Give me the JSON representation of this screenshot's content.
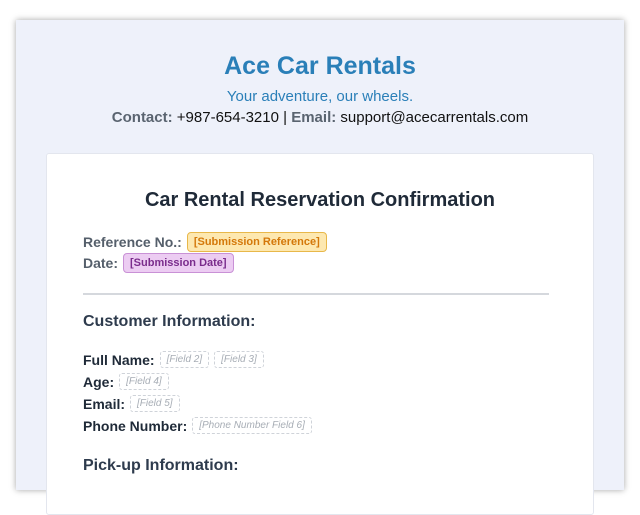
{
  "header": {
    "company_name": "Ace Car Rentals",
    "tagline": "Your adventure, our wheels.",
    "contact_label": "Contact:",
    "phone": "+987-654-3210",
    "separator": "|",
    "email_label": "Email:",
    "email": "support@acecarrentals.com"
  },
  "reservation": {
    "title": "Car Rental Reservation Confirmation",
    "reference_label": "Reference No.:",
    "reference_value": "[Submission Reference]",
    "date_label": "Date:",
    "date_value": "[Submission Date]"
  },
  "customer": {
    "section_title": "Customer Information:",
    "full_name_label": "Full Name:",
    "first_name_placeholder": "[Field 2]",
    "last_name_placeholder": "[Field 3]",
    "age_label": "Age:",
    "age_placeholder": "[Field 4]",
    "email_label": "Email:",
    "email_placeholder": "[Field 5]",
    "phone_label": "Phone Number:",
    "phone_placeholder": "[Phone Number Field 6]"
  },
  "pickup": {
    "section_title": "Pick-up Information:"
  },
  "colors": {
    "brand": "#2a7fb8",
    "reference_badge": "#fde8b0",
    "date_badge": "#ecccf2"
  }
}
